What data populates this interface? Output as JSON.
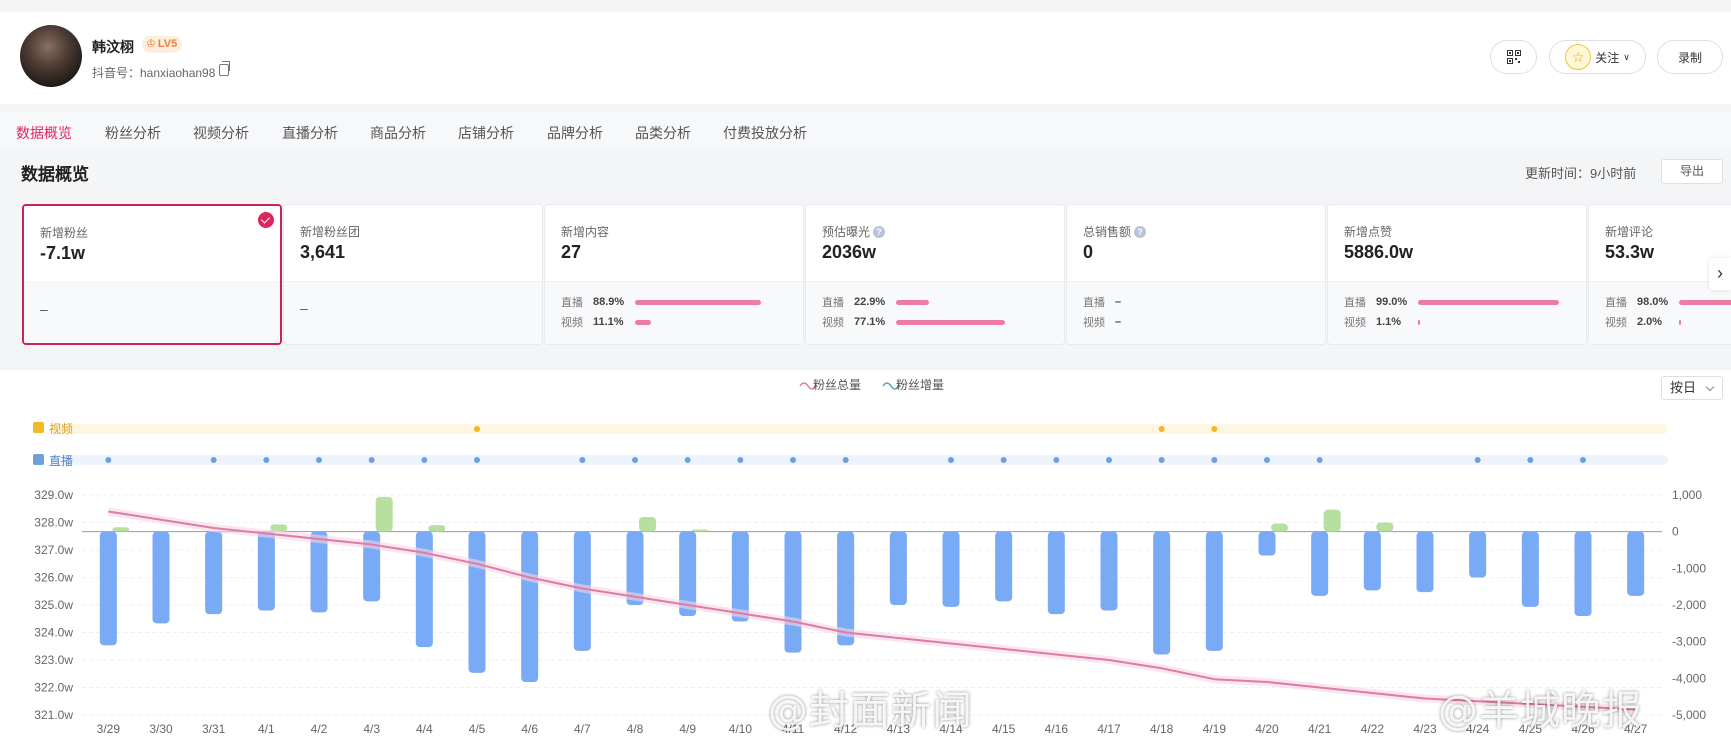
{
  "profile": {
    "name": "韩汶栩",
    "level": "LV5",
    "douyin_id": "抖音号：hanxiaohan98"
  },
  "header_actions": {
    "follow_label": "关注",
    "record_label": "录制"
  },
  "tabs": [
    {
      "label": "数据概览",
      "active": true
    },
    {
      "label": "粉丝分析"
    },
    {
      "label": "视频分析"
    },
    {
      "label": "直播分析"
    },
    {
      "label": "商品分析"
    },
    {
      "label": "店铺分析"
    },
    {
      "label": "品牌分析"
    },
    {
      "label": "品类分析"
    },
    {
      "label": "付费投放分析"
    }
  ],
  "section": {
    "title": "数据概览",
    "update_time": "更新时间：9小时前",
    "export_label": "导出"
  },
  "cards": [
    {
      "label": "新增粉丝",
      "value": "-7.1w",
      "selected": true,
      "bottom": "–"
    },
    {
      "label": "新增粉丝团",
      "value": "3,641",
      "bottom": "–"
    },
    {
      "label": "新增内容",
      "value": "27",
      "live_pct": "88.9%",
      "video_pct": "11.1%",
      "live_frac": 0.889,
      "video_frac": 0.111
    },
    {
      "label": "预估曝光",
      "help": true,
      "value": "2036w",
      "live_pct": "22.9%",
      "video_pct": "77.1%",
      "live_frac": 0.229,
      "video_frac": 0.771
    },
    {
      "label": "总销售额",
      "help": true,
      "value": "0",
      "live_pct": "–",
      "video_pct": "–",
      "live_frac": 0,
      "video_frac": 0
    },
    {
      "label": "新增点赞",
      "value": "5886.0w",
      "live_pct": "99.0%",
      "video_pct": "1.1%",
      "live_frac": 0.99,
      "video_frac": 0.011
    },
    {
      "label": "新增评论",
      "value": "53.3w",
      "live_pct": "98.0%",
      "video_pct": "2.0%",
      "live_frac": 0.98,
      "video_frac": 0.02
    }
  ],
  "split_labels": {
    "live": "直播",
    "video": "视频"
  },
  "interval_select": "按日",
  "watermarks": [
    "@封面新闻",
    "@羊城晚报"
  ],
  "colors": {
    "accent": "#e0245e",
    "line_total": "#e07aa6",
    "bar_negative": "#79aaf6",
    "bar_positive": "#b7e0a0",
    "video_marker": "#f2b826",
    "live_marker": "#6f9fdd"
  },
  "chart_data": {
    "type": "bar+line",
    "legend": [
      "粉丝总量",
      "粉丝增量"
    ],
    "lane_labels": {
      "video": "视频",
      "live": "直播"
    },
    "x": [
      "3/29",
      "3/30",
      "3/31",
      "4/1",
      "4/2",
      "4/3",
      "4/4",
      "4/5",
      "4/6",
      "4/7",
      "4/8",
      "4/9",
      "4/10",
      "4/11",
      "4/12",
      "4/13",
      "4/14",
      "4/15",
      "4/16",
      "4/17",
      "4/18",
      "4/19",
      "4/20",
      "4/21",
      "4/22",
      "4/23",
      "4/24",
      "4/25",
      "4/26",
      "4/27"
    ],
    "left_axis": {
      "min": 321.0,
      "max": 329.0,
      "ticks": [
        "329.0w",
        "328.0w",
        "327.0w",
        "326.0w",
        "325.0w",
        "324.0w",
        "323.0w",
        "322.0w",
        "321.0w"
      ]
    },
    "right_axis": {
      "min": -5000,
      "max": 1000,
      "ticks": [
        "1,000",
        "0",
        "-1,000",
        "-2,000",
        "-3,000",
        "-4,000",
        "-5,000"
      ]
    },
    "series": [
      {
        "name": "粉丝总量",
        "axis": "left",
        "values": [
          328.4,
          328.1,
          327.8,
          327.6,
          327.4,
          327.2,
          326.9,
          326.5,
          326.0,
          325.6,
          325.3,
          325.0,
          324.7,
          324.4,
          324.0,
          323.8,
          323.6,
          323.4,
          323.2,
          323.0,
          322.7,
          322.3,
          322.2,
          322.0,
          321.8,
          321.6,
          321.5,
          321.4,
          321.3,
          321.2
        ]
      },
      {
        "name": "粉丝增量",
        "axis": "right",
        "values": [
          -3100,
          -2500,
          -2250,
          -2150,
          -2200,
          -1900,
          -3150,
          -3850,
          -4100,
          -3250,
          -2000,
          -2300,
          -2450,
          -3300,
          -3100,
          -2000,
          -2050,
          -1900,
          -2250,
          -2150,
          -3350,
          -3250,
          -650,
          -1750,
          -1600,
          -1650,
          -1250,
          -2050,
          -2300,
          -1750
        ]
      },
      {
        "name": "增量正值",
        "axis": "right",
        "values": [
          120,
          0,
          0,
          200,
          0,
          950,
          180,
          0,
          0,
          0,
          400,
          60,
          0,
          0,
          0,
          0,
          0,
          0,
          0,
          0,
          0,
          0,
          220,
          600,
          250,
          0,
          0,
          0,
          0,
          0
        ]
      }
    ],
    "video_post_dates": [
      "4/5",
      "4/18",
      "4/19"
    ],
    "live_dates": [
      "3/29",
      "3/31",
      "4/1",
      "4/2",
      "4/3",
      "4/4",
      "4/5",
      "4/7",
      "4/8",
      "4/9",
      "4/10",
      "4/11",
      "4/12",
      "4/14",
      "4/15",
      "4/16",
      "4/17",
      "4/18",
      "4/19",
      "4/20",
      "4/21",
      "4/24",
      "4/25",
      "4/26"
    ]
  }
}
